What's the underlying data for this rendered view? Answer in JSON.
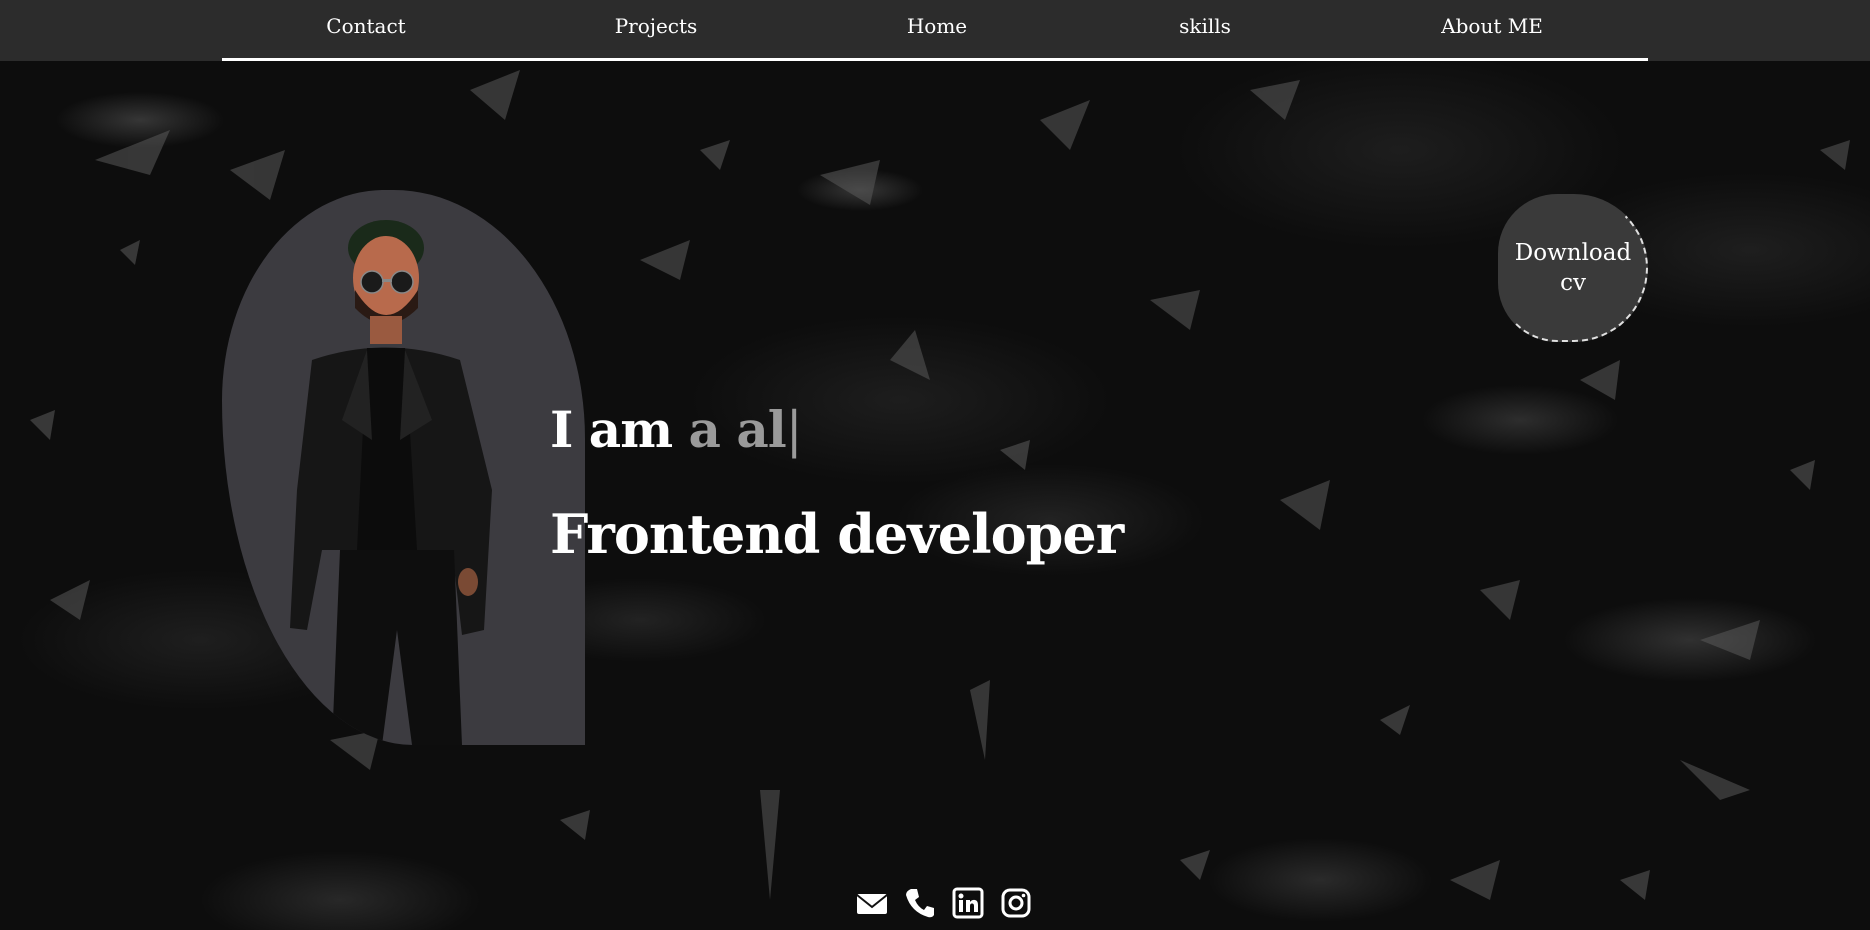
{
  "nav": {
    "items": [
      {
        "label": "Contact"
      },
      {
        "label": "Projects"
      },
      {
        "label": "Home"
      },
      {
        "label": "skills"
      },
      {
        "label": "About ME"
      }
    ]
  },
  "hero": {
    "iam_prefix": "I am",
    "typed_text": "a al",
    "cursor": "|",
    "role": "Frontend developer",
    "portrait_alt": "portrait-photo"
  },
  "download_cv": {
    "label_line1": "Download",
    "label_line2": "cv"
  },
  "social": {
    "icons": [
      "envelope-icon",
      "phone-icon",
      "linkedin-icon",
      "instagram-icon"
    ]
  },
  "colors": {
    "nav_bg": "#323232",
    "underline": "#ffffff",
    "typed_text": "#9a9a9a",
    "portrait_bg": "#3c3b40",
    "cv_bg": "#3a3a3a"
  }
}
